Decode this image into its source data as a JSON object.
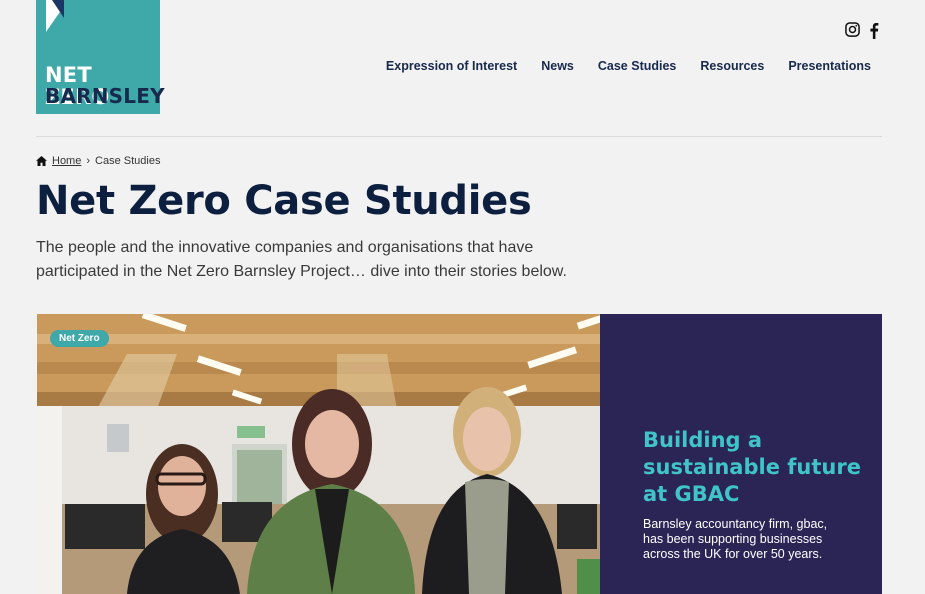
{
  "logo": {
    "line1": "NET ZERO",
    "line2": "BARNSLEY"
  },
  "social": {
    "icons": [
      "instagram-icon",
      "facebook-icon"
    ]
  },
  "nav": {
    "items": [
      "Expression of Interest",
      "News",
      "Case Studies",
      "Resources",
      "Presentations"
    ]
  },
  "breadcrumb": {
    "home": "Home",
    "separator": "›",
    "current": "Case Studies"
  },
  "page": {
    "title": "Net Zero Case Studies",
    "intro": "The people and the innovative companies and organisations that have participated in the Net Zero Barnsley Project… dive into their stories below."
  },
  "card": {
    "tag": "Net Zero",
    "title": "Building a sustainable future at GBAC",
    "description": "Barnsley accountancy firm, gbac, has been supporting businesses across the UK for over 50 years."
  },
  "colors": {
    "brand_teal": "#3fa8a9",
    "navy": "#0c1f3f",
    "panel_purple": "#2b2556",
    "accent_cyan": "#3fc4c7"
  }
}
